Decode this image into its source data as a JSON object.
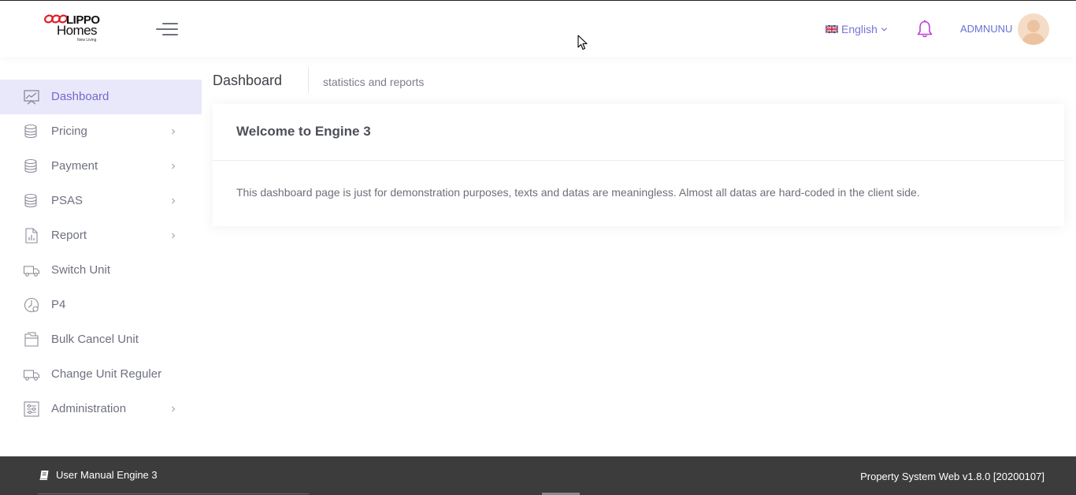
{
  "header": {
    "brand": {
      "lippo": "LIPPO",
      "homes": "Homes",
      "tagline": "New Living"
    },
    "language": {
      "label": "English",
      "flag_icon": "uk-flag-icon"
    },
    "notifications_icon": "bell-icon",
    "user": {
      "name": "ADMNUNU"
    }
  },
  "sidebar": {
    "items": [
      {
        "label": "Dashboard",
        "icon": "chart-icon",
        "active": true,
        "has_submenu": false
      },
      {
        "label": "Pricing",
        "icon": "coins-icon",
        "active": false,
        "has_submenu": true
      },
      {
        "label": "Payment",
        "icon": "coins-icon",
        "active": false,
        "has_submenu": true
      },
      {
        "label": "PSAS",
        "icon": "coins-icon",
        "active": false,
        "has_submenu": true
      },
      {
        "label": "Report",
        "icon": "report-icon",
        "active": false,
        "has_submenu": true
      },
      {
        "label": "Switch Unit",
        "icon": "truck-icon",
        "active": false,
        "has_submenu": false
      },
      {
        "label": "P4",
        "icon": "clock-icon",
        "active": false,
        "has_submenu": false
      },
      {
        "label": "Bulk Cancel Unit",
        "icon": "folder-icon",
        "active": false,
        "has_submenu": false
      },
      {
        "label": "Change Unit Reguler",
        "icon": "truck-icon",
        "active": false,
        "has_submenu": false
      },
      {
        "label": "Administration",
        "icon": "settings-sliders-icon",
        "active": false,
        "has_submenu": true
      }
    ]
  },
  "subheader": {
    "title": "Dashboard",
    "description": "statistics and reports"
  },
  "card": {
    "title": "Welcome to Engine 3",
    "body": "This dashboard page is just for demonstration purposes, texts and datas are meaningless. Almost all datas are hard-coded in the client side."
  },
  "footer": {
    "manual_label": "User Manual Engine 3",
    "version": "Property System Web v1.8.0 [20200107]"
  },
  "colors": {
    "accent": "#716aca",
    "active_bg": "#e9e8fb",
    "footer_bg": "#3c3c3c",
    "bell": "#c13fd8",
    "brand_red": "#e0202a"
  }
}
